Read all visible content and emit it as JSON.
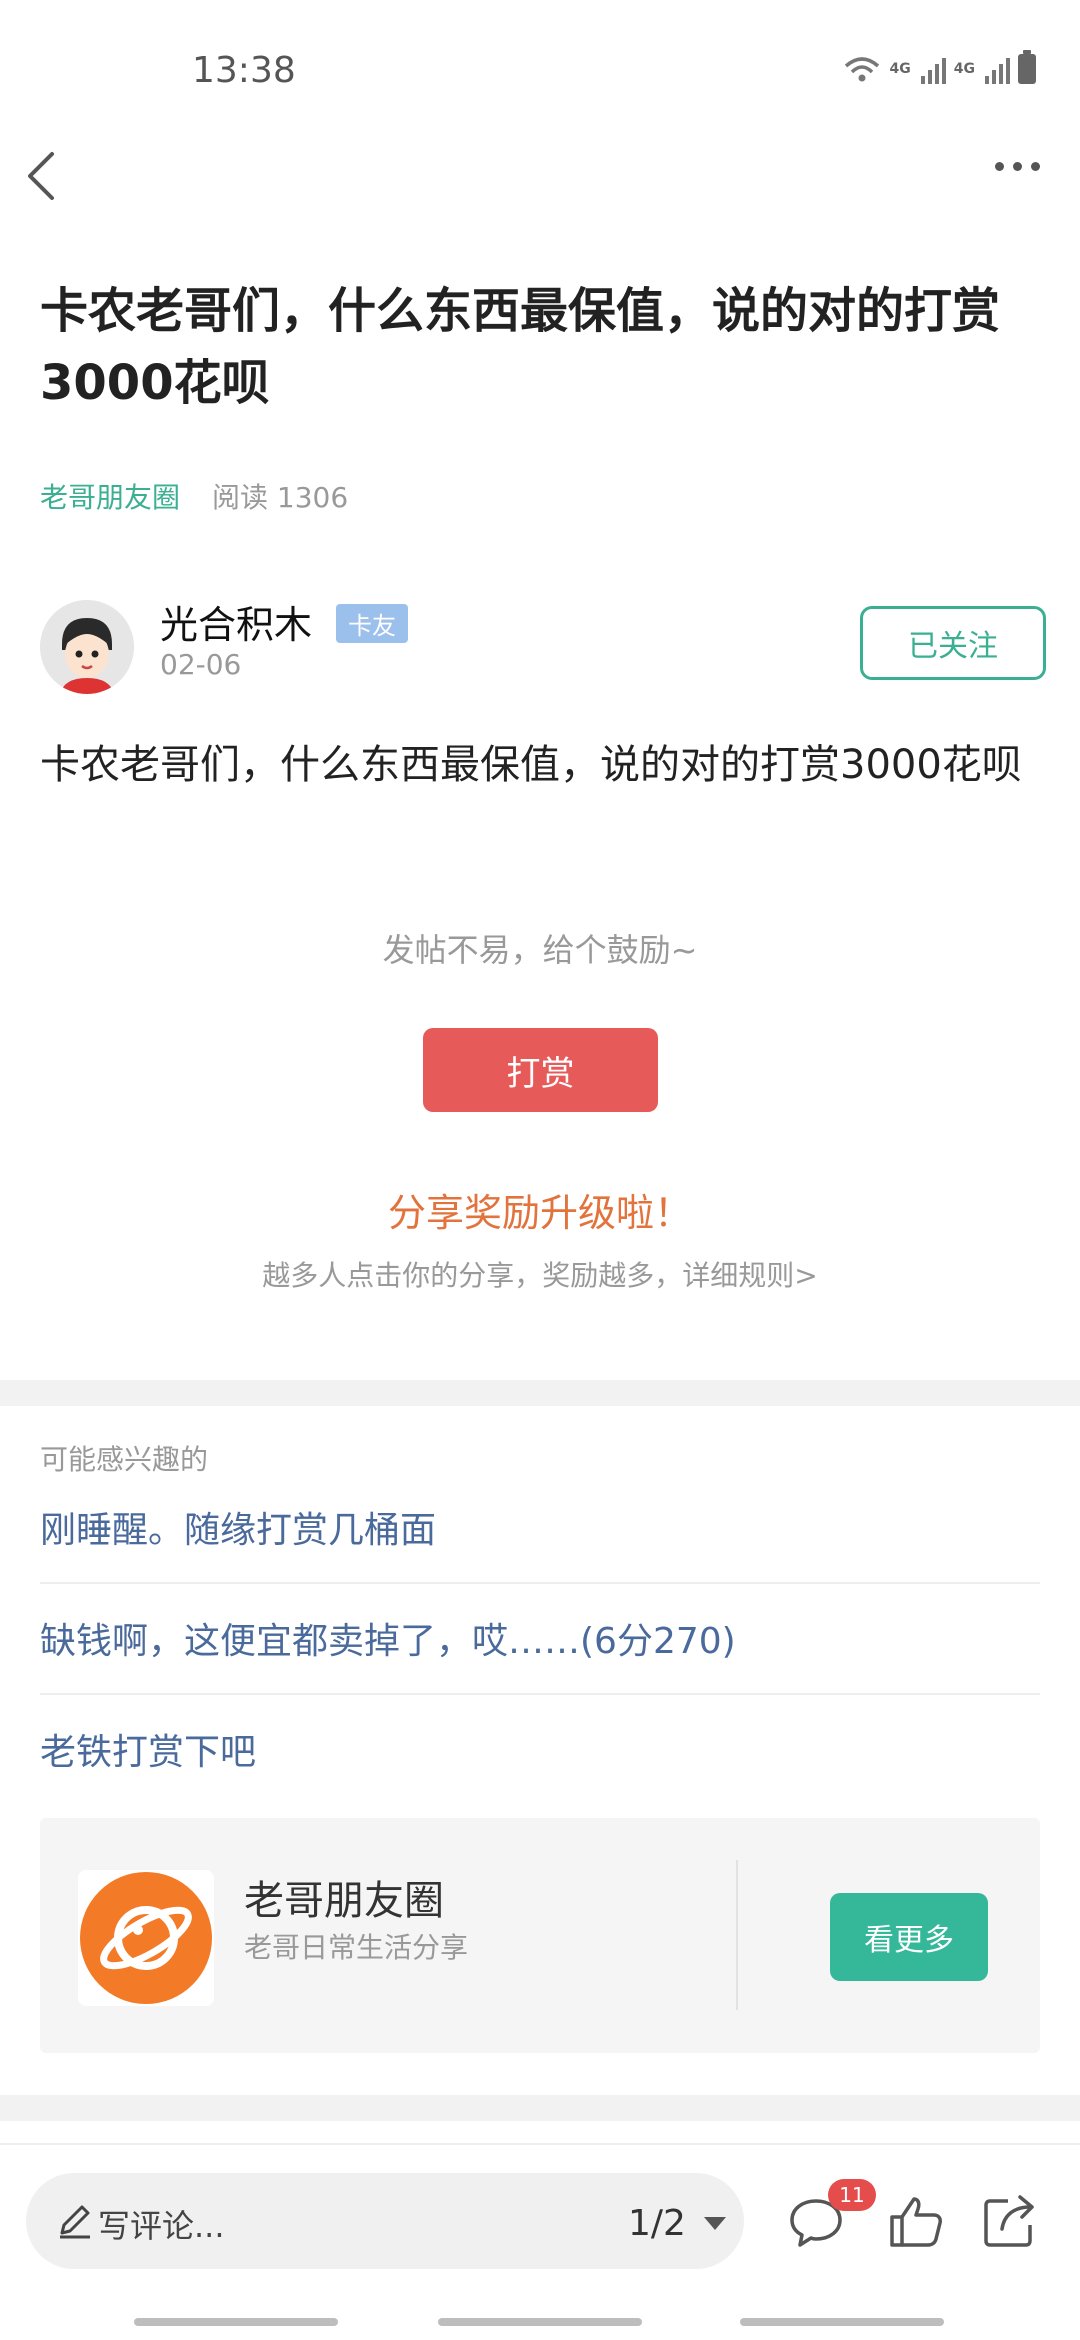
{
  "status_bar": {
    "time": "13:38",
    "network": [
      "4G",
      "4G"
    ],
    "icons": [
      "wifi-icon",
      "signal-icon",
      "signal-icon",
      "battery-icon"
    ]
  },
  "nav": {
    "back_icon": "back-icon",
    "more_icon": "more-icon"
  },
  "post": {
    "title": "卡农老哥们，什么东西最保值，说的对的打赏3000花呗",
    "circle": "老哥朋友圈",
    "reads": "阅读 1306",
    "author": {
      "name": "光合积木",
      "tag": "卡友",
      "date": "02-06",
      "follow_label": "已关注"
    },
    "body": "卡农老哥们，什么东西最保值，说的对的打赏3000花呗"
  },
  "reward": {
    "encourage": "发帖不易，给个鼓励~",
    "button": "打赏",
    "share_title": "分享奖励升级啦！",
    "share_subtitle": "越多人点击你的分享，奖励越多，详细规则>"
  },
  "recommend": {
    "header": "可能感兴趣的",
    "items": [
      "刚睡醒。随缘打赏几桶面",
      "缺钱啊，这便宜都卖掉了，哎……(6分270)",
      "老铁打赏下吧"
    ]
  },
  "circle_card": {
    "name": "老哥朋友圈",
    "desc": "老哥日常生活分享",
    "button": "看更多"
  },
  "bottom_bar": {
    "comment_placeholder": "写评论...",
    "page_indicator": "1/2",
    "comment_count": "11"
  },
  "colors": {
    "accent_green": "#3aaf92",
    "reward_red": "#e75a5a",
    "share_orange": "#e2733d",
    "link_blue": "#4a6a9c",
    "badge_red": "#e54d4d"
  }
}
